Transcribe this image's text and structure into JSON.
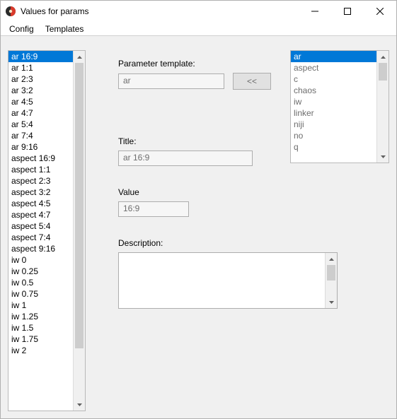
{
  "window": {
    "title": "Values for params"
  },
  "menu": {
    "config": "Config",
    "templates": "Templates"
  },
  "leftList": {
    "items": [
      "ar 16:9",
      "ar 1:1",
      "ar 2:3",
      "ar 3:2",
      "ar 4:5",
      "ar 4:7",
      "ar 5:4",
      "ar 7:4",
      "ar 9:16",
      "aspect 16:9",
      "aspect 1:1",
      "aspect 2:3",
      "aspect 3:2",
      "aspect 4:5",
      "aspect 4:7",
      "aspect 5:4",
      "aspect 7:4",
      "aspect 9:16",
      "iw  0",
      "iw  0.25",
      "iw  0.5",
      "iw  0.75",
      "iw  1",
      "iw  1.25",
      "iw  1.5",
      "iw  1.75",
      "iw  2"
    ],
    "selectedIndex": 0
  },
  "rightList": {
    "items": [
      "ar",
      "aspect",
      "c",
      "chaos",
      "iw",
      "linker",
      "niji",
      "no",
      "q"
    ],
    "selectedIndex": 0
  },
  "form": {
    "paramTemplateLabel": "Parameter template:",
    "paramTemplateValue": "ar",
    "moveButton": "<<",
    "titleLabel": "Title:",
    "titleValue": "ar 16:9",
    "valueLabel": "Value",
    "valueValue": "16:9",
    "descriptionLabel": "Description:",
    "descriptionValue": ""
  }
}
